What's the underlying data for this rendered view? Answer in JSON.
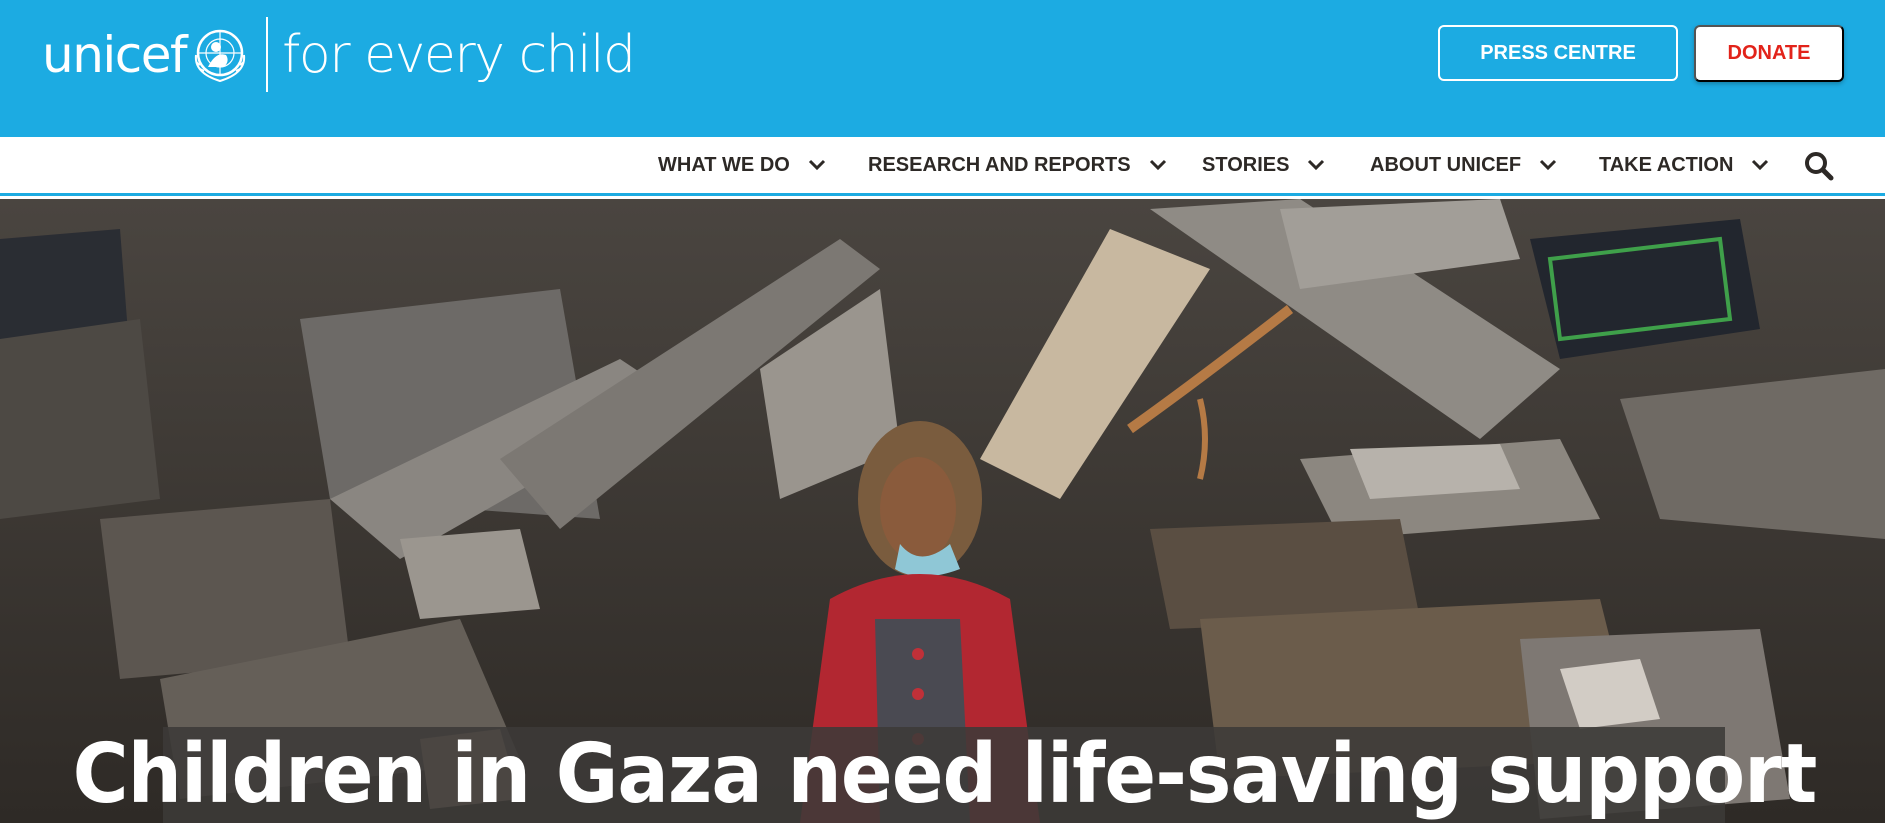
{
  "brand": {
    "wordmark": "unicef",
    "tagline": "for every child",
    "color": "#1cabe2"
  },
  "header": {
    "press_label": "PRESS CENTRE",
    "donate_label": "DONATE",
    "donate_color": "#e2231a"
  },
  "nav": {
    "items": [
      {
        "label": "WHAT WE DO",
        "icon": "chevron-down-icon"
      },
      {
        "label": "RESEARCH AND REPORTS",
        "icon": "chevron-down-icon"
      },
      {
        "label": "STORIES",
        "icon": "chevron-down-icon"
      },
      {
        "label": "ABOUT UNICEF",
        "icon": "chevron-down-icon"
      },
      {
        "label": "TAKE ACTION",
        "icon": "chevron-down-icon"
      }
    ],
    "search_icon": "search-icon"
  },
  "hero": {
    "headline": "Children in Gaza need life-saving support"
  }
}
